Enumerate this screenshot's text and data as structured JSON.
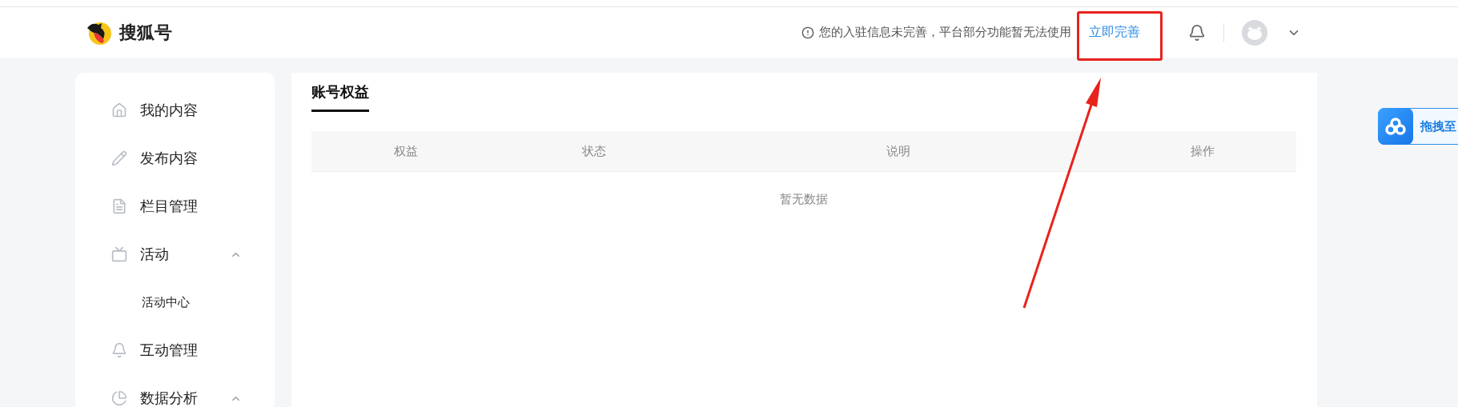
{
  "header": {
    "logo": "搜狐号",
    "notice": "您的入驻信息未完善，平台部分功能暂无法使用",
    "notice_link": "立即完善"
  },
  "sidebar": {
    "items": [
      {
        "label": "我的内容",
        "expanded": false
      },
      {
        "label": "发布内容",
        "expanded": false
      },
      {
        "label": "栏目管理",
        "expanded": false
      },
      {
        "label": "活动",
        "expanded": true,
        "children": [
          {
            "label": "活动中心"
          }
        ]
      },
      {
        "label": "互动管理",
        "expanded": false
      },
      {
        "label": "数据分析",
        "expanded": true
      }
    ]
  },
  "main": {
    "tabs": [
      {
        "label": "账号权益",
        "selected": true
      }
    ],
    "table": {
      "columns": [
        "权益",
        "状态",
        "说明",
        "操作"
      ],
      "empty": "暂无数据"
    }
  },
  "float_button": {
    "label": "拖拽至"
  },
  "annotation": {
    "highlight": true,
    "arrow": true
  }
}
